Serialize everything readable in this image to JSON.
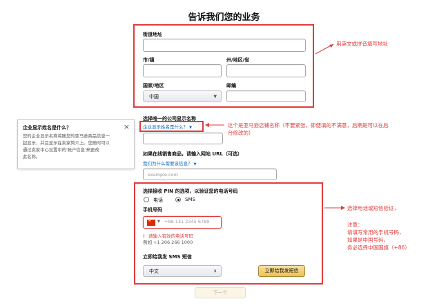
{
  "page": {
    "title": "告诉我们您的业务"
  },
  "address": {
    "street_label": "街道地址",
    "city_label": "市/镇",
    "state_label": "州/地区/省",
    "country_label": "国家/地区",
    "country_value": "中国",
    "zip_label": "邮编"
  },
  "store": {
    "name_label": "选择唯一的公司显示名称",
    "tooltip_link": "企业显示姓名是什么？",
    "website_label": "如果在线销售商品，请输入网站 URL（可选）",
    "website_link": "我们为什么需要该信息？",
    "website_placeholder": "example.com"
  },
  "tooltip": {
    "title": "企业显示姓名是什么？",
    "close": "×",
    "body_lines": [
      "您的企业显示名称将随您的亚马逊商品信息一",
      "起显示，并且显示在卖家简介上。您随时可以",
      "通过卖家中心设置中的'帐户信息'来更改",
      "此名称。"
    ]
  },
  "verify": {
    "method_label": "选择接收 PIN 的选项，以验证您的电话号码",
    "option_phone": "电话",
    "option_sms": "SMS",
    "phone_label": "手机号码",
    "phone_placeholder": "+86 131 2345 6789",
    "error": "请输入有效的电话号码",
    "example": "例如 +1 206 266 1000",
    "sms_label": "立即给我发 SMS 短信",
    "language_value": "中文",
    "send_button": "立即给我发短信"
  },
  "footer": {
    "next_button": "下一个"
  },
  "annotations": {
    "address_note": "用英文或拼音填写地址",
    "name_note_line1": "这个是亚马逊店铺名称（不要紧张，即便填的不满意，后期是可以在后",
    "name_note_line2": "台修改的）",
    "verify_note_line1": "选择电话或短信验证，",
    "verify_note_line2": "注意：",
    "verify_note_line3": "请填写常用的手机号码，",
    "verify_note_line4": "如果是中国号码，",
    "verify_note_line5": "务必选择中国国旗（+86）"
  },
  "colors": {
    "annotation_red": "#e23a3a",
    "link_blue": "#0066c0",
    "button_yellow": "#f0c14b"
  }
}
